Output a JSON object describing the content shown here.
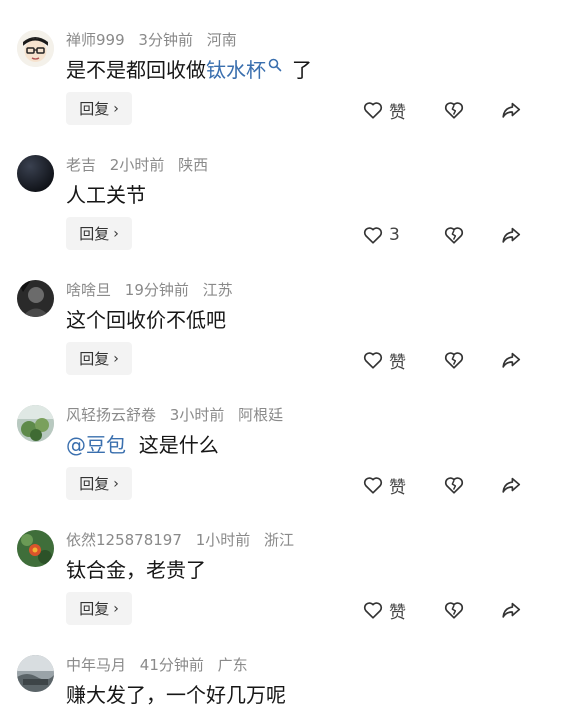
{
  "comments": [
    {
      "username": "禅师999",
      "time": "3分钟前",
      "location": "河南",
      "text_before": "是不是都回收做",
      "search_link": "钛水杯",
      "text_after": "了",
      "reply_label": "回复",
      "like_label": "赞",
      "avatar": "cartoon-glasses-avatar"
    },
    {
      "username": "老吉",
      "time": "2小时前",
      "location": "陕西",
      "text": "人工关节",
      "reply_label": "回复",
      "like_label": "3",
      "avatar": "dark-avatar"
    },
    {
      "username": "啥啥旦",
      "time": "19分钟前",
      "location": "江苏",
      "text": "这个回收价不低吧",
      "reply_label": "回复",
      "like_label": "赞",
      "avatar": "dark-grey-avatar"
    },
    {
      "username": "风轻扬云舒卷",
      "time": "3小时前",
      "location": "阿根廷",
      "mention": "@豆包",
      "text": "这是什么",
      "reply_label": "回复",
      "like_label": "赞",
      "avatar": "green-plant-avatar"
    },
    {
      "username": "依然125878197",
      "time": "1小时前",
      "location": "浙江",
      "text": "钛合金，老贵了",
      "reply_label": "回复",
      "like_label": "赞",
      "avatar": "flower-avatar"
    },
    {
      "username": "中年马月",
      "time": "41分钟前",
      "location": "广东",
      "text": "赚大发了，一个好几万呢",
      "avatar": "landscape-avatar"
    }
  ],
  "colors": {
    "meta": "#8a8a8a",
    "link": "#3a6fae",
    "reply_bg": "#f3f3f3"
  }
}
